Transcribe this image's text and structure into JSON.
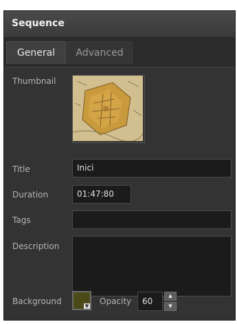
{
  "header": {
    "title": "Sequence"
  },
  "tabs": [
    {
      "label": "General",
      "active": true
    },
    {
      "label": "Advanced",
      "active": false
    }
  ],
  "form": {
    "thumbnail_label": "Thumbnail",
    "title_label": "Title",
    "title_value": "Inici",
    "duration_label": "Duration",
    "duration_value": "01:47:80",
    "tags_label": "Tags",
    "tags_value": "",
    "description_label": "Description",
    "description_value": "",
    "background_label": "Background",
    "background_color": "#4c4a18",
    "opacity_label": "Opacity",
    "opacity_value": "60"
  },
  "icons": {
    "swatch_dropdown": "triangle-down-icon",
    "spin_up": "triangle-up-icon",
    "spin_down": "triangle-down-icon"
  }
}
